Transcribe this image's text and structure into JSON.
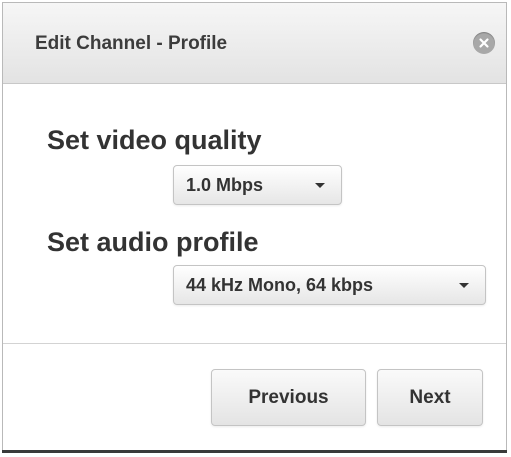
{
  "dialog": {
    "title": "Edit Channel - Profile",
    "close_icon": "close-icon"
  },
  "video": {
    "label": "Set video quality",
    "selected": "1.0 Mbps"
  },
  "audio": {
    "label": "Set audio profile",
    "selected": "44 kHz Mono, 64 kbps"
  },
  "footer": {
    "previous_label": "Previous",
    "next_label": "Next"
  },
  "colors": {
    "header_bg": "#e9e9e9",
    "text": "#333333",
    "close_button": "#a8a8a8"
  }
}
